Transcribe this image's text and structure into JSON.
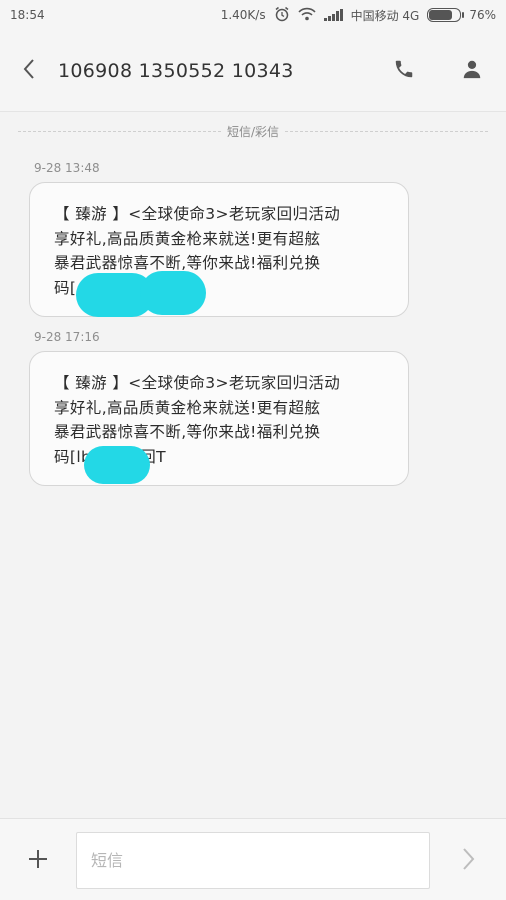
{
  "status_bar": {
    "time": "18:54",
    "net_speed": "1.40K/s",
    "carrier": "中国移动 4G",
    "battery": "76%",
    "battery_level": 0.76
  },
  "header": {
    "contact": "106908 1350552 10343",
    "icons": [
      "back-icon",
      "phone-icon",
      "contact-icon"
    ]
  },
  "thread": {
    "divider_label": "短信/彩信",
    "messages": [
      {
        "time": "9-28 13:48",
        "lines": [
          "【 臻游 】<全球使命3>老玩家回归活动",
          "享好礼,高品质黄金枪来就送!更有超舷",
          "暴君武器惊喜不断,等你来战!福利兑换",
          "码[ ]退订回T"
        ]
      },
      {
        "time": "9-28 17:16",
        "lines": [
          "【 臻游 】<全球使命3>老玩家回归活动",
          "享好礼,高品质黄金枪来就送!更有超舷",
          "暴君武器惊喜不断,等你来战!福利兑换",
          "码[lb ],退订回T"
        ]
      }
    ]
  },
  "composer": {
    "placeholder": "短信",
    "icons": [
      "plus-icon",
      "send-icon"
    ]
  },
  "colors": {
    "redaction": "#23d8e6",
    "background": "#f3f3f3"
  }
}
